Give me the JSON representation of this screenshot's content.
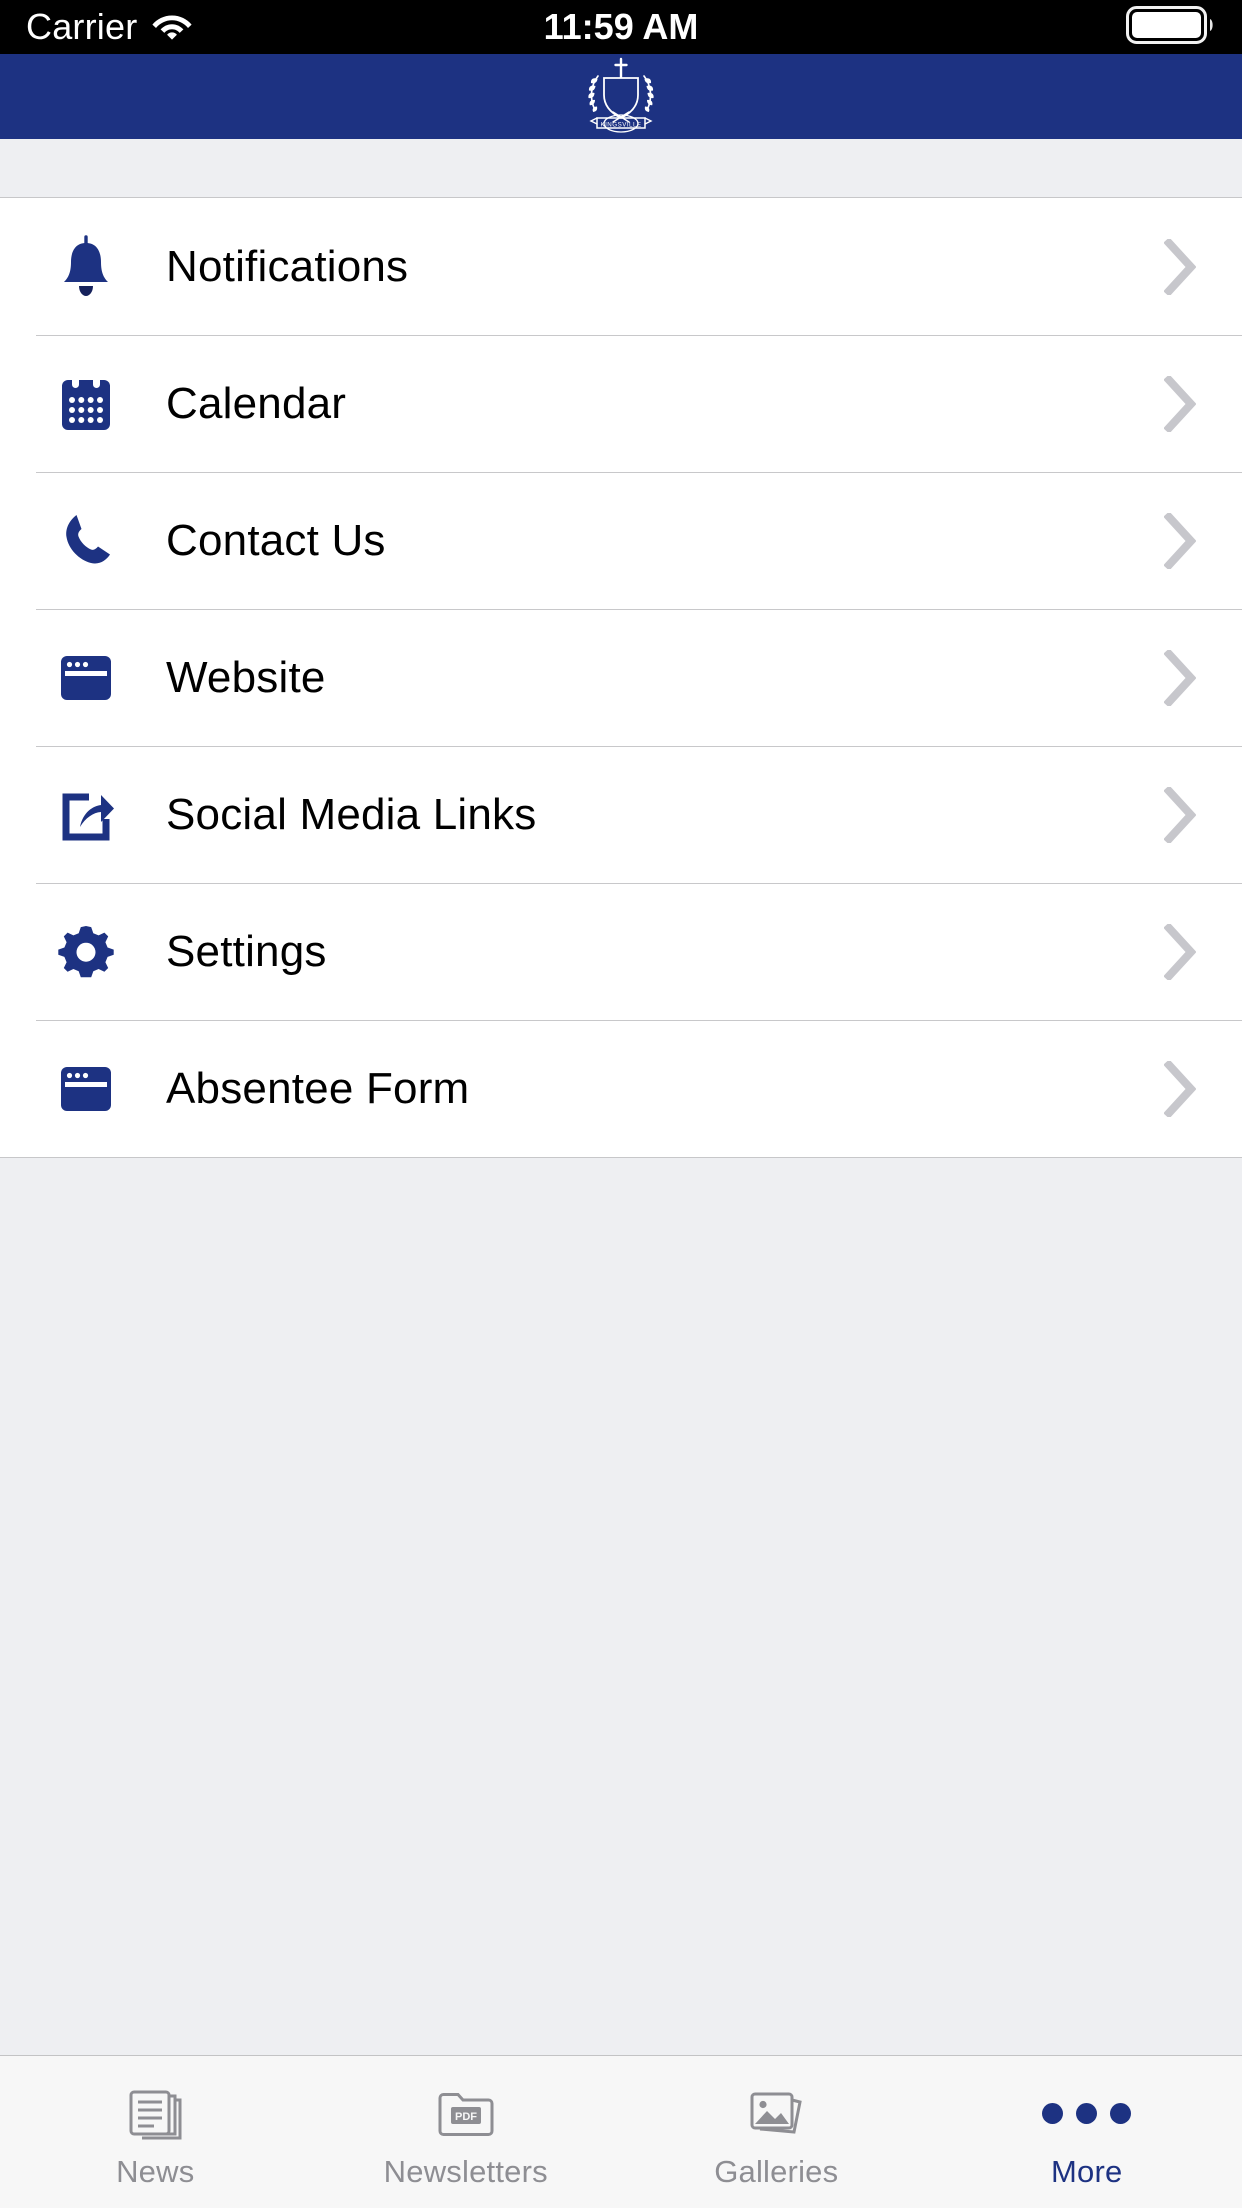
{
  "status_bar": {
    "carrier": "Carrier",
    "wifi_icon": "wifi-icon",
    "time": "11:59 AM",
    "battery_icon": "battery-full-icon"
  },
  "header": {
    "logo_icon": "school-crest-logo",
    "logo_text": "KINGSVILLE",
    "background_color": "#1d3282"
  },
  "menu": {
    "items": [
      {
        "label": "Notifications",
        "icon": "bell-icon"
      },
      {
        "label": "Calendar",
        "icon": "calendar-icon"
      },
      {
        "label": "Contact Us",
        "icon": "phone-icon"
      },
      {
        "label": "Website",
        "icon": "browser-window-icon"
      },
      {
        "label": "Social Media Links",
        "icon": "share-icon"
      },
      {
        "label": "Settings",
        "icon": "gear-icon"
      },
      {
        "label": "Absentee Form",
        "icon": "browser-window-icon"
      }
    ],
    "disclosure_icon": "chevron-right-icon",
    "icon_color": "#1d3282",
    "chevron_color": "#c7c7cc"
  },
  "tab_bar": {
    "tabs": [
      {
        "label": "News",
        "icon": "news-stack-icon",
        "active": false
      },
      {
        "label": "Newsletters",
        "icon": "pdf-folder-icon",
        "active": false
      },
      {
        "label": "Galleries",
        "icon": "photos-icon",
        "active": false
      },
      {
        "label": "More",
        "icon": "more-dots-icon",
        "active": true
      }
    ],
    "inactive_color": "#8e8e93",
    "active_color": "#1d3282"
  }
}
